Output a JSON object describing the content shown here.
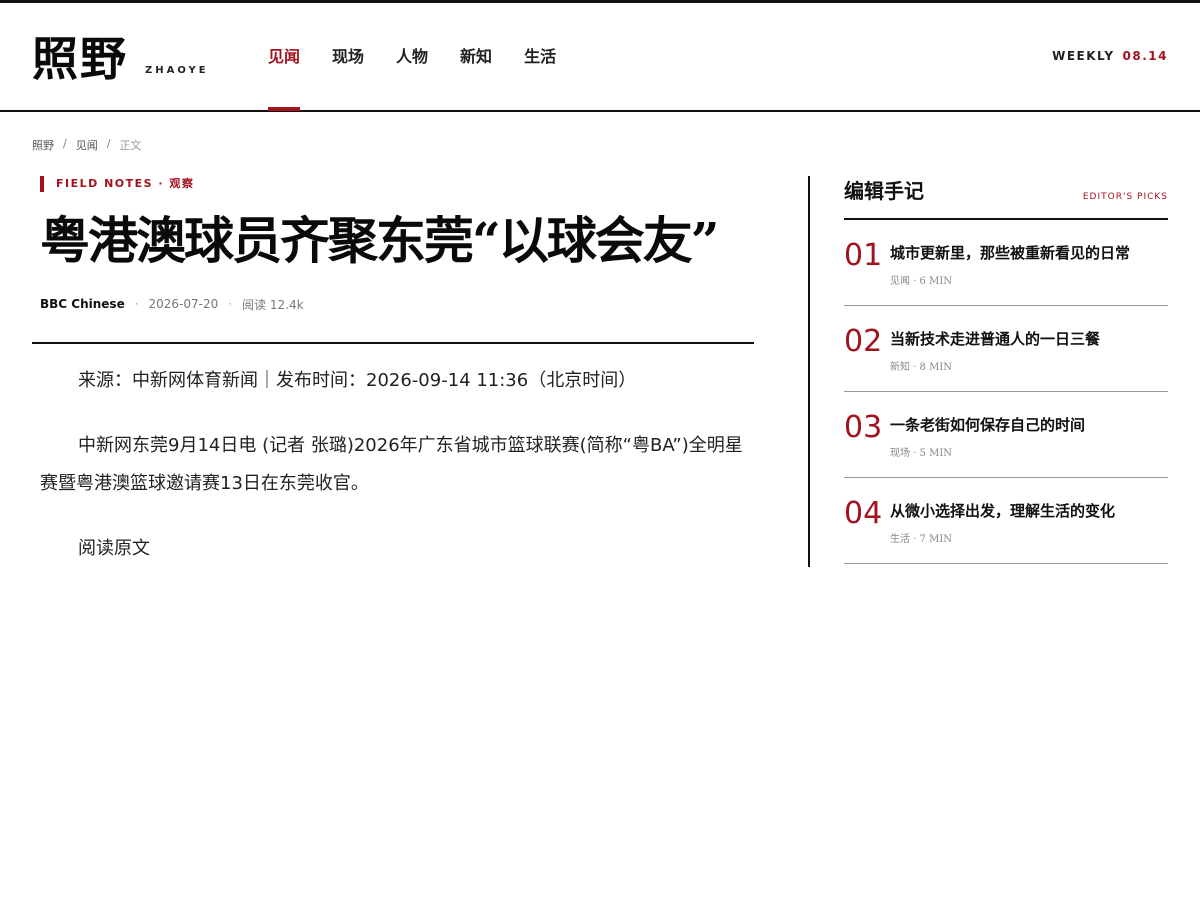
{
  "masthead": {
    "logo": "照野",
    "logo_sub": "ZHAOYE",
    "nav": [
      "见闻",
      "现场",
      "人物",
      "新知",
      "生活"
    ],
    "active_nav": "见闻",
    "weekly_label": "WEEKLY",
    "weekly_date": "08.14"
  },
  "breadcrumb": {
    "items": [
      "照野",
      "见闻",
      "正文"
    ],
    "separator": "/"
  },
  "article": {
    "kicker": "FIELD NOTES · 观察",
    "headline": "粤港澳球员齐聚东莞“以球会友”",
    "author": "BBC Chinese",
    "date": "2026-07-20",
    "reads": "阅读 12.4k",
    "paragraphs": [
      "来源：中新网体育新闻｜发布时间：2026-09-14 11:36（北京时间）",
      "中新网东莞9月14日电 (记者 张璐)2026年广东省城市篮球联赛(简称“粤BA”)全明星赛暨粤港澳篮球邀请赛13日在东莞收官。",
      "阅读原文"
    ]
  },
  "sidebar": {
    "title": "编辑手记",
    "tag": "EDITOR'S PICKS",
    "picks": [
      {
        "num": "01",
        "title": "城市更新里，那些被重新看见的日常",
        "meta": "见闻 · 6 MIN"
      },
      {
        "num": "02",
        "title": "当新技术走进普通人的一日三餐",
        "meta": "新知 · 8 MIN"
      },
      {
        "num": "03",
        "title": "一条老街如何保存自己的时间",
        "meta": "现场 · 5 MIN"
      },
      {
        "num": "04",
        "title": "从微小选择出发，理解生活的变化",
        "meta": "生活 · 7 MIN"
      }
    ]
  },
  "colors": {
    "accent": "#a3121f",
    "text": "#111111",
    "muted": "#888888"
  }
}
